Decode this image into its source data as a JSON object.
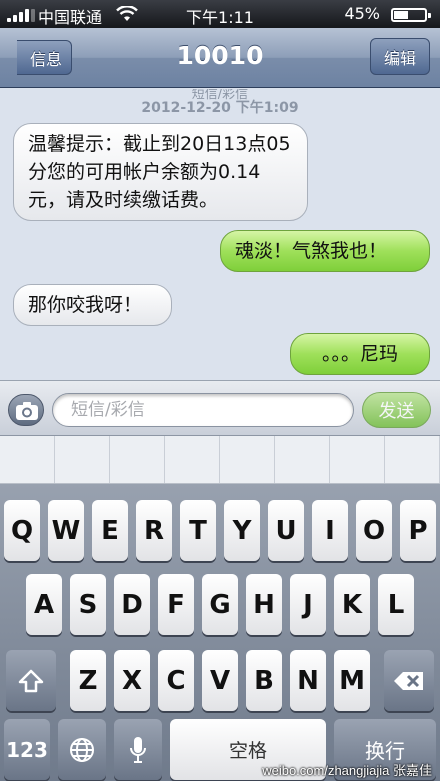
{
  "status": {
    "carrier": "中国联通",
    "time": "下午1:11",
    "battery_pct": "45%",
    "battery_level": 0.45,
    "icons": [
      "signal-bars-icon",
      "wifi-icon",
      "battery-icon"
    ]
  },
  "nav": {
    "back_label": "信息",
    "title": "10010",
    "edit_label": "编辑"
  },
  "conversation": {
    "peek_text": "短信/彩信",
    "timestamp": "2012-12-20 下午1:09",
    "messages": [
      {
        "from": "them",
        "text": "温馨提示：截止到20日13点05分您的可用帐户余额为0.14元，请及时续缴话费。"
      },
      {
        "from": "me",
        "text": "魂淡！气煞我也！"
      },
      {
        "from": "them",
        "text": "那你咬我呀！"
      },
      {
        "from": "me",
        "text": "。。。尼玛"
      }
    ]
  },
  "input": {
    "placeholder": "短信/彩信",
    "send_label": "发送",
    "camera_icon": "camera-icon"
  },
  "keyboard": {
    "row1": [
      "Q",
      "W",
      "E",
      "R",
      "T",
      "Y",
      "U",
      "I",
      "O",
      "P"
    ],
    "row2": [
      "A",
      "S",
      "D",
      "F",
      "G",
      "H",
      "J",
      "K",
      "L"
    ],
    "row3": [
      "Z",
      "X",
      "C",
      "V",
      "B",
      "N",
      "M"
    ],
    "num_label": "123",
    "space_label": "空格",
    "return_label": "换行",
    "icons": [
      "shift-icon",
      "backspace-icon",
      "globe-icon",
      "microphone-icon"
    ]
  },
  "watermark": "weibo.com/zhangjiajia 张嘉佳",
  "colors": {
    "outgoing_bubble": "#8fd64a",
    "incoming_bubble": "#f2f3f5",
    "nav_bar": "#8296b4",
    "send_button": "#6bbd2f"
  }
}
